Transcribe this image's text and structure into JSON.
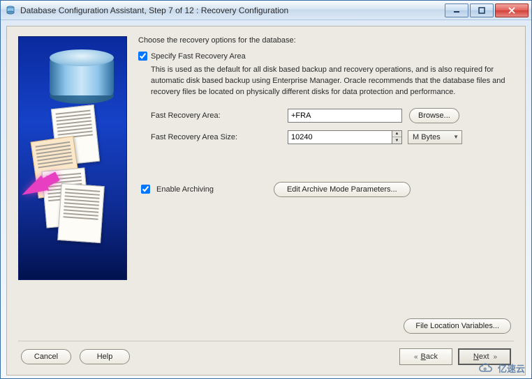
{
  "window": {
    "title": "Database Configuration Assistant, Step 7 of 12 : Recovery Configuration"
  },
  "intro": "Choose the recovery options for the database:",
  "fra": {
    "checkbox_label": "Specify Fast Recovery Area",
    "checked": true,
    "description": "This is used as the default for all disk based backup and recovery operations, and is also required for automatic disk based backup using Enterprise Manager. Oracle recommends that the database files and recovery files be located on physically different disks for data protection and performance.",
    "area_label": "Fast Recovery Area:",
    "area_value": "+FRA",
    "browse_label": "Browse...",
    "size_label": "Fast Recovery Area Size:",
    "size_value": "10240",
    "size_unit": "M Bytes"
  },
  "archiving": {
    "checkbox_label": "Enable Archiving",
    "checked": true,
    "edit_label": "Edit Archive Mode Parameters..."
  },
  "file_loc_label": "File Location Variables...",
  "nav": {
    "cancel": "Cancel",
    "help": "Help",
    "back": "Back",
    "next": "Next"
  },
  "watermark": "亿速云"
}
